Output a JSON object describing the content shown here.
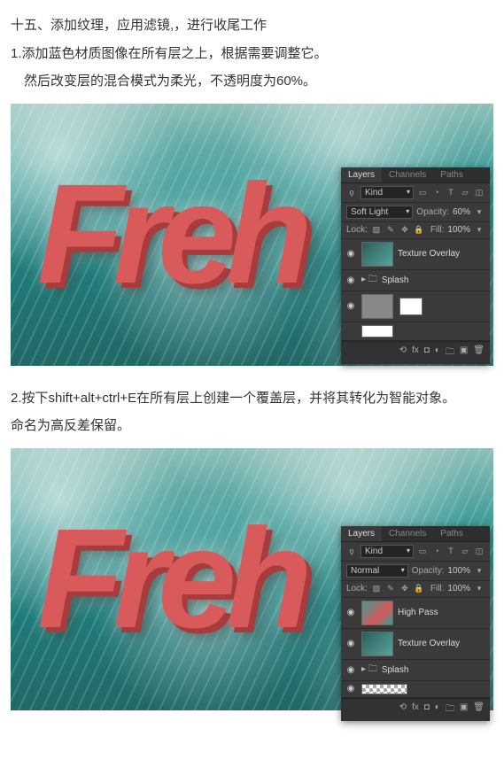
{
  "heading": "十五、添加纹理，应用滤镜,，进行收尾工作",
  "step1_line1": "1.添加蓝色材质图像在所有层之上，根据需要调整它。",
  "step1_line2": "然后改变层的混合模式为柔光，不透明度为60%。",
  "step2_line1": "2.按下shift+alt+ctrl+E在所有层上创建一个覆盖层，并将其转化为智能对象。",
  "step2_line2": "命名为高反差保留。",
  "panel1": {
    "tabs": {
      "layers": "Layers",
      "channels": "Channels",
      "paths": "Paths"
    },
    "kind": "Kind",
    "blend": "Soft Light",
    "opacity_lbl": "Opacity:",
    "opacity_val": "60%",
    "lock_lbl": "Lock:",
    "fill_lbl": "Fill:",
    "fill_val": "100%",
    "layers": [
      {
        "name": "Texture Overlay"
      },
      {
        "name": "Splash"
      }
    ]
  },
  "panel2": {
    "tabs": {
      "layers": "Layers",
      "channels": "Channels",
      "paths": "Paths"
    },
    "kind": "Kind",
    "blend": "Normal",
    "opacity_lbl": "Opacity:",
    "opacity_val": "100%",
    "lock_lbl": "Lock:",
    "fill_lbl": "Fill:",
    "fill_val": "100%",
    "layers": [
      {
        "name": "High Pass"
      },
      {
        "name": "Texture Overlay"
      },
      {
        "name": "Splash"
      }
    ]
  },
  "letters": "Freh"
}
